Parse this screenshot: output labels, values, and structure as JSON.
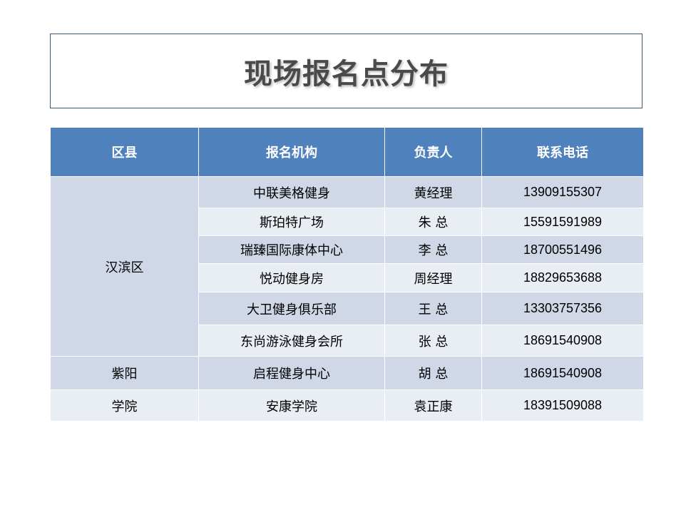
{
  "title": "现场报名点分布",
  "table": {
    "headers": [
      "区县",
      "报名机构",
      "负责人",
      "联系电话"
    ],
    "groups": [
      {
        "district": "汉滨区",
        "rows": [
          {
            "org": "中联美格健身",
            "person": "黄经理",
            "phone": "13909155307"
          },
          {
            "org": "斯珀特广场",
            "person": "朱  总",
            "phone": "15591591989"
          },
          {
            "org": "瑞臻国际康体中心",
            "person": "李  总",
            "phone": "18700551496"
          },
          {
            "org": "悦动健身房",
            "person": "周经理",
            "phone": "18829653688"
          },
          {
            "org": "大卫健身俱乐部",
            "person": "王  总",
            "phone": "13303757356"
          },
          {
            "org": "东尚游泳健身会所",
            "person": "张  总",
            "phone": "18691540908"
          }
        ]
      },
      {
        "district": "紫阳",
        "rows": [
          {
            "org": "启程健身中心",
            "person": "胡  总",
            "phone": "18691540908"
          }
        ]
      },
      {
        "district": "学院",
        "rows": [
          {
            "org": "安康学院",
            "person": "袁正康",
            "phone": "18391509088"
          }
        ]
      }
    ]
  },
  "colors": {
    "header_bg": "#4f81bd",
    "row_dark": "#d0d8e8",
    "row_light": "#e9edf4",
    "title_border": "#3b5a72"
  }
}
